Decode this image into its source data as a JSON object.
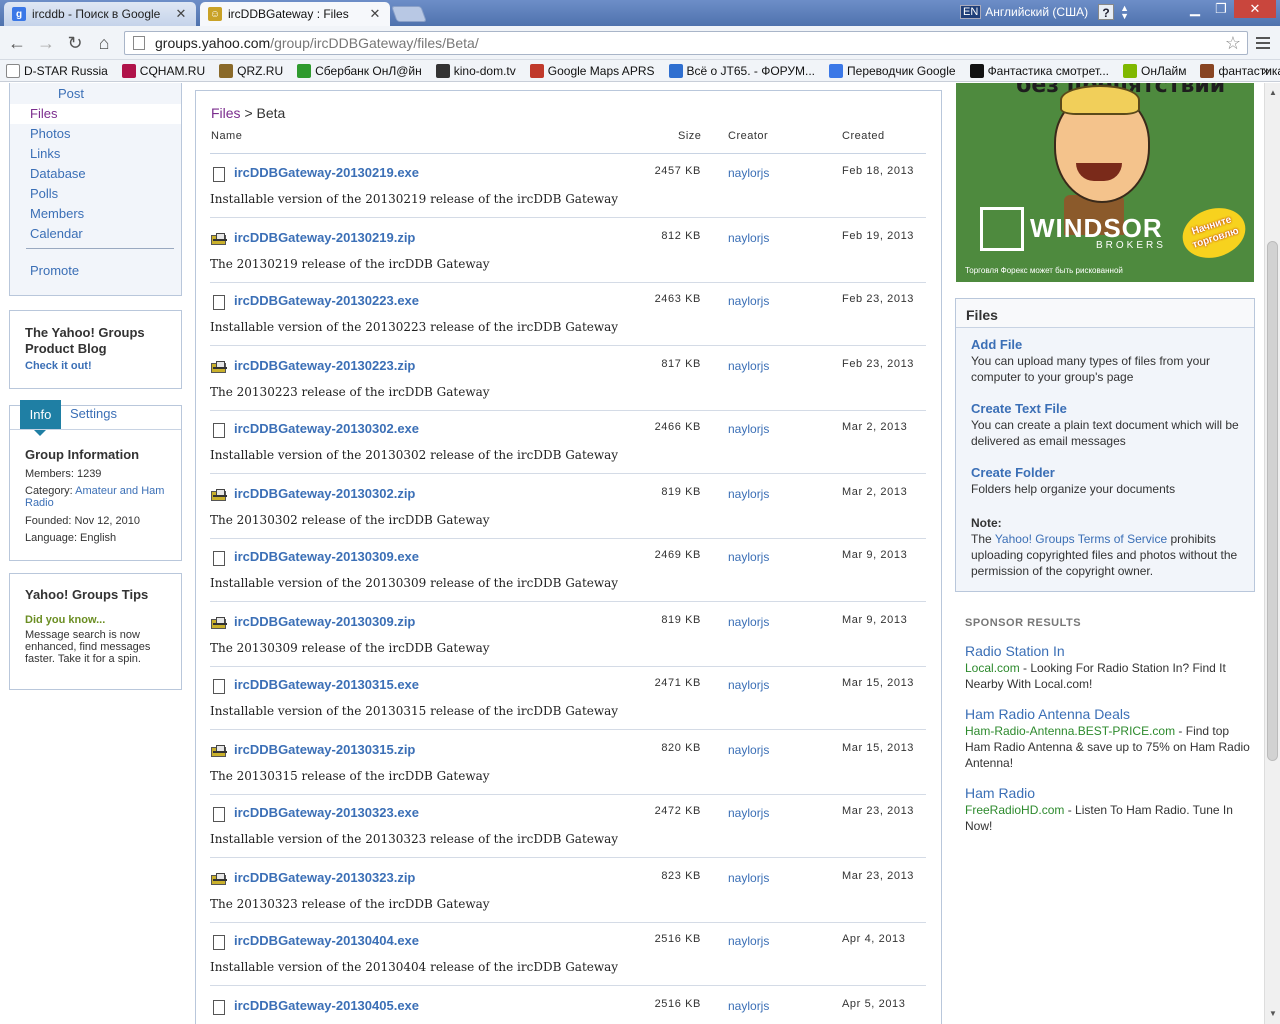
{
  "browser": {
    "tabs": [
      {
        "label": "ircddb - Поиск в Google",
        "active": false,
        "favicon": "google-icon"
      },
      {
        "label": "ircDDBGateway : Files",
        "active": true,
        "favicon": "yahoo-groups-icon"
      }
    ],
    "language_indicator": {
      "code": "EN",
      "label": "Английский (США)"
    },
    "url_host": "groups.yahoo.com",
    "url_path": "/group/ircDDBGateway/files/Beta/",
    "bookmarks": [
      {
        "label": "D-STAR Russia",
        "icon": "page-icon",
        "color": "#ffffff"
      },
      {
        "label": "CQHAM.RU",
        "icon": "cqham-icon",
        "color": "#b0134a"
      },
      {
        "label": "QRZ.RU",
        "icon": "qrz-icon",
        "color": "#8a6a2a"
      },
      {
        "label": "Сбербанк ОнЛ@йн",
        "icon": "sberbank-icon",
        "color": "#2e9a2e"
      },
      {
        "label": "kino-dom.tv",
        "icon": "film-icon",
        "color": "#333333"
      },
      {
        "label": "Google Maps APRS",
        "icon": "car-icon",
        "color": "#c0392b"
      },
      {
        "label": "Всё о JT65. - ФОРУМ...",
        "icon": "globe-icon",
        "color": "#2f6fd0"
      },
      {
        "label": "Переводчик Google",
        "icon": "translate-icon",
        "color": "#3b78e7"
      },
      {
        "label": "Фантастика смотрет...",
        "icon": "hd-icon",
        "color": "#111111"
      },
      {
        "label": "ОнЛайм",
        "icon": "onlime-icon",
        "color": "#7fb800"
      },
      {
        "label": "фантастика",
        "icon": "fantasy-icon",
        "color": "#884422"
      }
    ]
  },
  "sidebar": {
    "nav": [
      {
        "label": "Post",
        "active": false,
        "sub": true
      },
      {
        "label": "Files",
        "active": true,
        "sub": false
      },
      {
        "label": "Photos",
        "active": false,
        "sub": false
      },
      {
        "label": "Links",
        "active": false,
        "sub": false
      },
      {
        "label": "Database",
        "active": false,
        "sub": false
      },
      {
        "label": "Polls",
        "active": false,
        "sub": false
      },
      {
        "label": "Members",
        "active": false,
        "sub": false
      },
      {
        "label": "Calendar",
        "active": false,
        "sub": false
      }
    ],
    "promote": "Promote",
    "blog": {
      "title": "The Yahoo! Groups Product Blog",
      "link": "Check it out!"
    },
    "info": {
      "tab_info": "Info",
      "tab_settings": "Settings",
      "heading": "Group Information",
      "members": "Members: 1239",
      "category_label": "Category:",
      "category_value": "Amateur and Ham Radio",
      "founded": "Founded: Nov 12, 2010",
      "language": "Language: English"
    },
    "tips": {
      "title": "Yahoo! Groups Tips",
      "did_you_know": "Did you know...",
      "text": "Message search is now enhanced, find messages faster. Take it for a spin."
    }
  },
  "main": {
    "breadcrumb_files": "Files",
    "breadcrumb_sep": ">",
    "breadcrumb_current": "Beta",
    "columns": {
      "name": "Name",
      "size": "Size",
      "creator": "Creator",
      "created": "Created"
    },
    "files": [
      {
        "name": "ircDDBGateway-20130219.exe",
        "type": "exe",
        "size": "2457 KB",
        "creator": "naylorjs",
        "created": "Feb 18, 2013",
        "description": "Installable version of the 20130219 release of the ircDDB Gateway"
      },
      {
        "name": "ircDDBGateway-20130219.zip",
        "type": "zip",
        "size": "812 KB",
        "creator": "naylorjs",
        "created": "Feb 19, 2013",
        "description": "The 20130219 release of the ircDDB Gateway"
      },
      {
        "name": "ircDDBGateway-20130223.exe",
        "type": "exe",
        "size": "2463 KB",
        "creator": "naylorjs",
        "created": "Feb 23, 2013",
        "description": "Installable version of the 20130223 release of the ircDDB Gateway"
      },
      {
        "name": "ircDDBGateway-20130223.zip",
        "type": "zip",
        "size": "817 KB",
        "creator": "naylorjs",
        "created": "Feb 23, 2013",
        "description": "The 20130223 release of the ircDDB Gateway"
      },
      {
        "name": "ircDDBGateway-20130302.exe",
        "type": "exe",
        "size": "2466 KB",
        "creator": "naylorjs",
        "created": "Mar 2, 2013",
        "description": "Installable version of the 20130302 release of the ircDDB Gateway"
      },
      {
        "name": "ircDDBGateway-20130302.zip",
        "type": "zip",
        "size": "819 KB",
        "creator": "naylorjs",
        "created": "Mar 2, 2013",
        "description": "The 20130302 release of the ircDDB Gateway"
      },
      {
        "name": "ircDDBGateway-20130309.exe",
        "type": "exe",
        "size": "2469 KB",
        "creator": "naylorjs",
        "created": "Mar 9, 2013",
        "description": "Installable version of the 20130309 release of the ircDDB Gateway"
      },
      {
        "name": "ircDDBGateway-20130309.zip",
        "type": "zip",
        "size": "819 KB",
        "creator": "naylorjs",
        "created": "Mar 9, 2013",
        "description": "The 20130309 release of the ircDDB Gateway"
      },
      {
        "name": "ircDDBGateway-20130315.exe",
        "type": "exe",
        "size": "2471 KB",
        "creator": "naylorjs",
        "created": "Mar 15, 2013",
        "description": "Installable version of the 20130315 release of the ircDDB Gateway"
      },
      {
        "name": "ircDDBGateway-20130315.zip",
        "type": "zip",
        "size": "820 KB",
        "creator": "naylorjs",
        "created": "Mar 15, 2013",
        "description": "The 20130315 release of the ircDDB Gateway"
      },
      {
        "name": "ircDDBGateway-20130323.exe",
        "type": "exe",
        "size": "2472 KB",
        "creator": "naylorjs",
        "created": "Mar 23, 2013",
        "description": "Installable version of the 20130323 release of the ircDDB Gateway"
      },
      {
        "name": "ircDDBGateway-20130323.zip",
        "type": "zip",
        "size": "823 KB",
        "creator": "naylorjs",
        "created": "Mar 23, 2013",
        "description": "The 20130323 release of the ircDDB Gateway"
      },
      {
        "name": "ircDDBGateway-20130404.exe",
        "type": "exe",
        "size": "2516 KB",
        "creator": "naylorjs",
        "created": "Apr 4, 2013",
        "description": "Installable version of the 20130404 release of the ircDDB Gateway"
      },
      {
        "name": "ircDDBGateway-20130405.exe",
        "type": "exe",
        "size": "2516 KB",
        "creator": "naylorjs",
        "created": "Apr 5, 2013",
        "description": ""
      }
    ]
  },
  "right": {
    "ad": {
      "headline": "без препятствий",
      "brand": "WINDSOR",
      "sub": "BROKERS",
      "badge": "Начните торговлю",
      "disclaimer": "Торговля Форекс может быть рискованной"
    },
    "files_box": {
      "title": "Files",
      "add_file": "Add File",
      "add_file_desc": "You can upload many types of files from your computer to your group's page",
      "create_text": "Create Text File",
      "create_text_desc": "You can create a plain text document which will be delivered as email messages",
      "create_folder": "Create Folder",
      "create_folder_desc": "Folders help organize your documents",
      "note_label": "Note:",
      "note_pre": "The",
      "note_link": "Yahoo! Groups Terms of Service",
      "note_post": "prohibits uploading copyrighted files and photos without the permission of the copyright owner."
    },
    "sponsor": {
      "heading": "SPONSOR RESULTS",
      "results": [
        {
          "title": "Radio Station In",
          "url": "Local.com",
          "desc": " - Looking For Radio Station In? Find It Nearby With Local.com!"
        },
        {
          "title": "Ham Radio Antenna Deals",
          "url": "Ham-Radio-Antenna.BEST-PRICE.com",
          "desc": " - Find top Ham Radio Antenna & save up to 75% on Ham Radio Antenna!"
        },
        {
          "title": "Ham Radio",
          "url": "FreeRadioHD.com",
          "desc": " - Listen To Ham Radio. Tune In Now!"
        }
      ]
    }
  }
}
